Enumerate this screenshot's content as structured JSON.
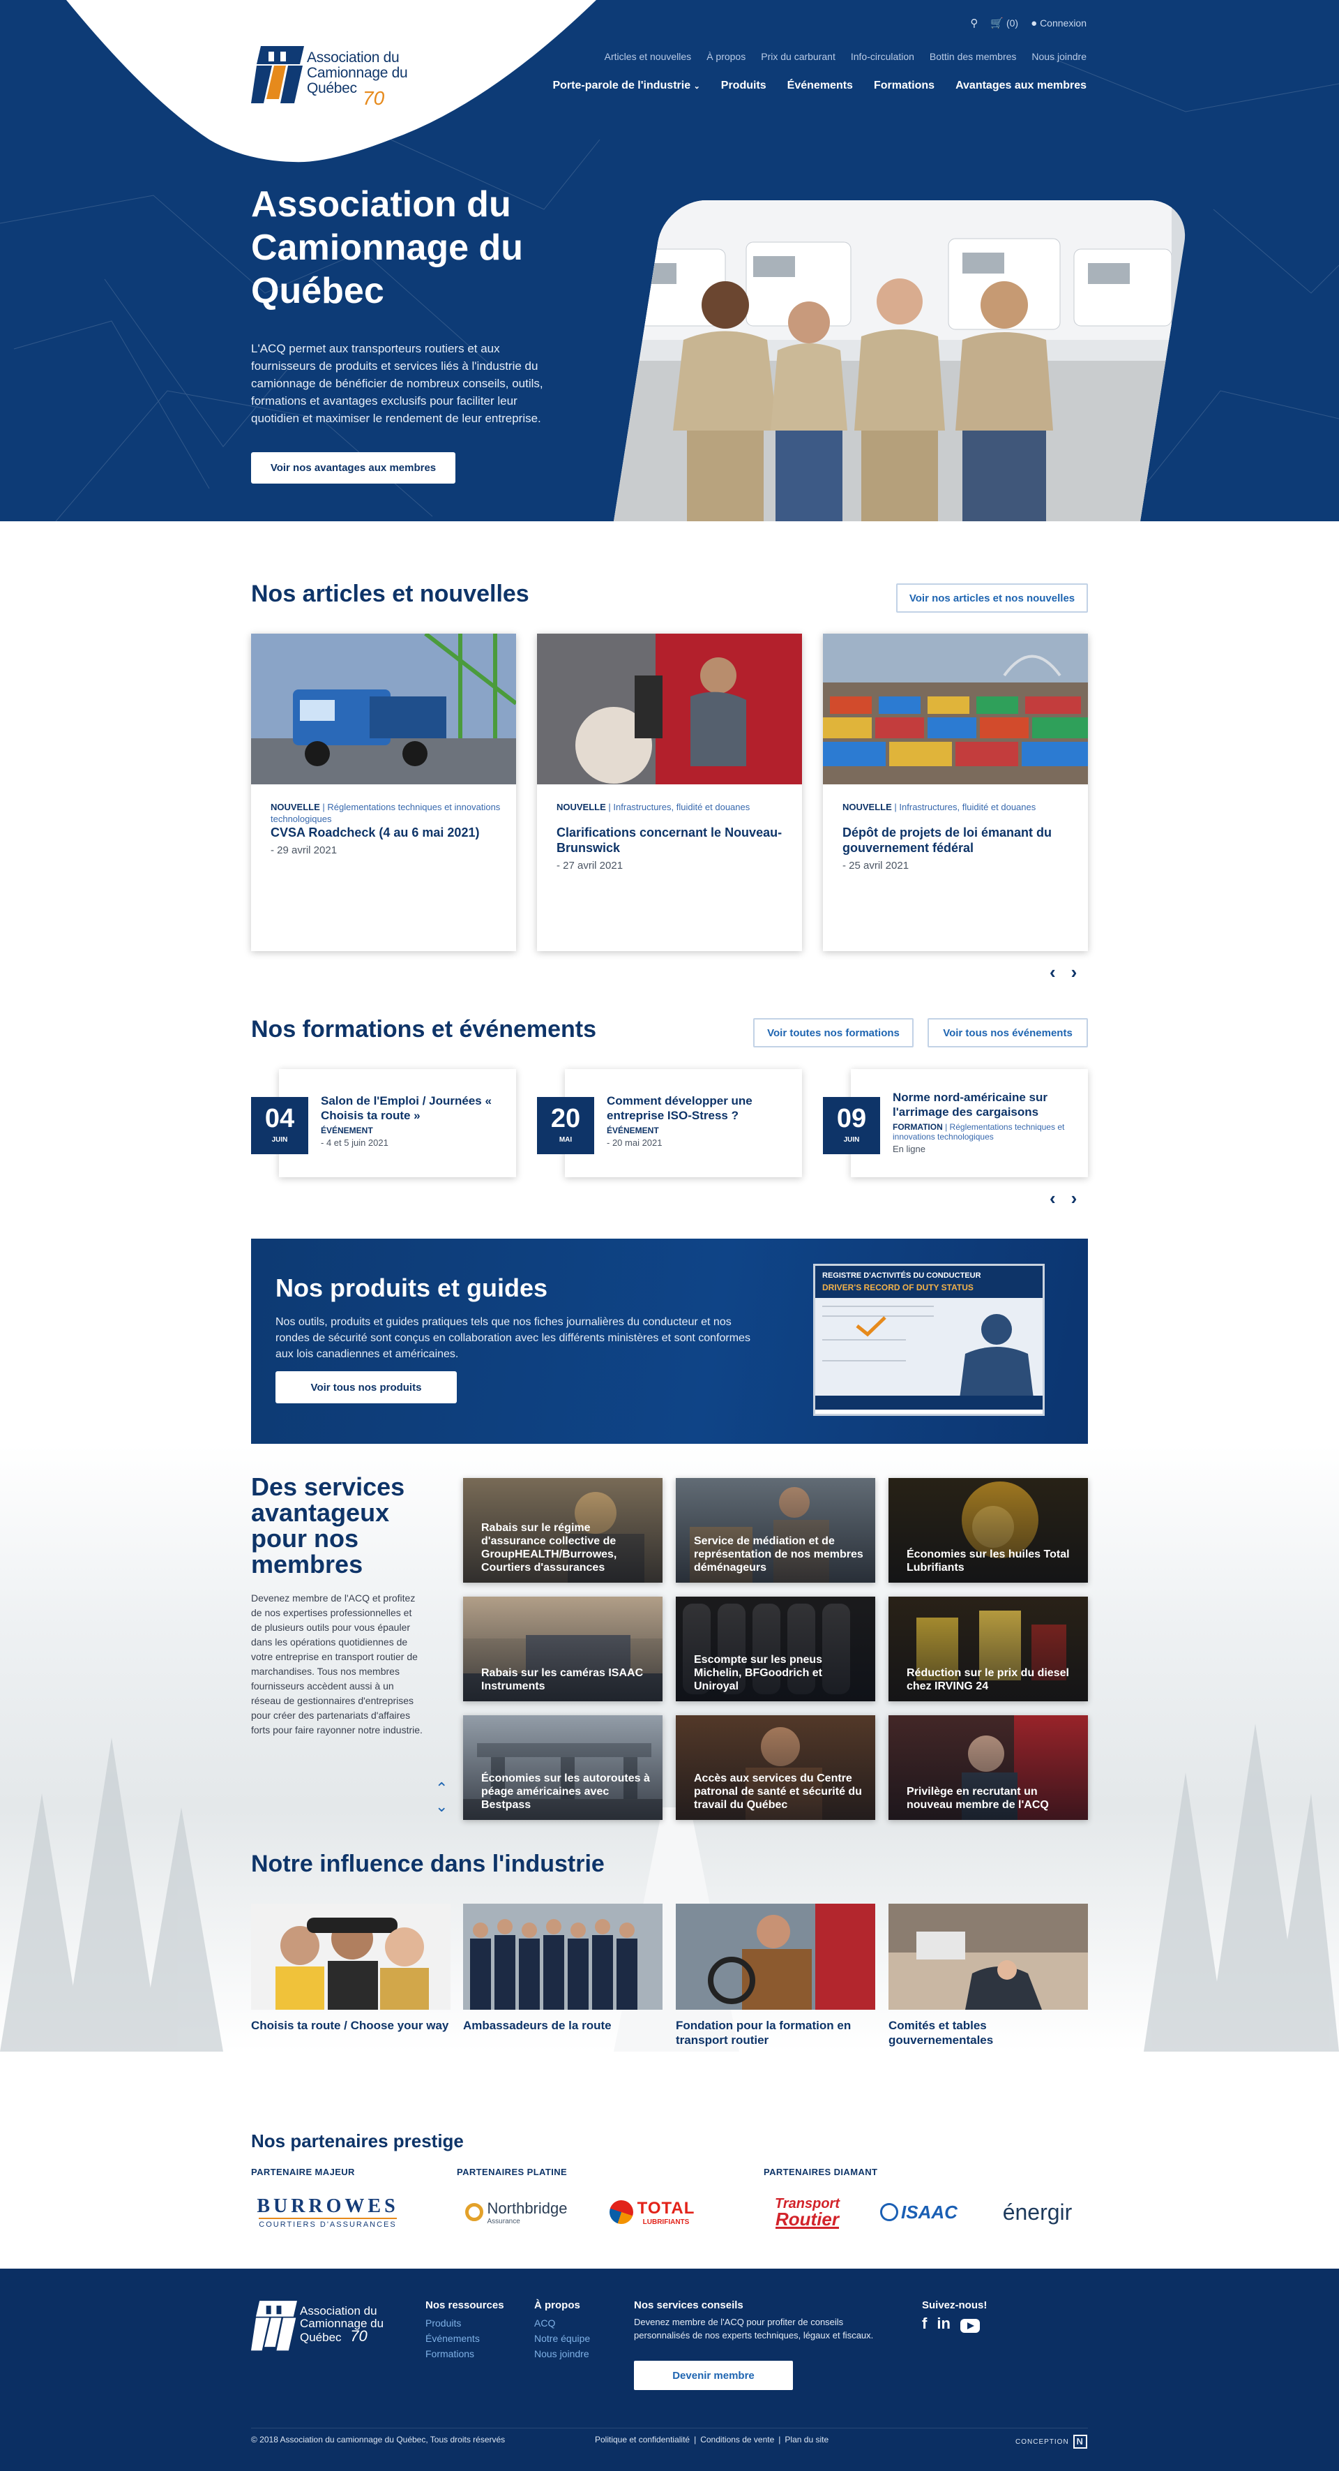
{
  "header": {
    "logo_line1": "Association du",
    "logo_line2": "Camionnage du",
    "logo_line3": "Québec",
    "logo_70": "70",
    "cart_label": "(0)",
    "login_label": "Connexion",
    "top_links": [
      "Articles et nouvelles",
      "À propos",
      "Prix du carburant",
      "Info-circulation",
      "Bottin des membres",
      "Nous joindre"
    ],
    "main_nav": [
      "Porte-parole de l'industrie",
      "Produits",
      "Événements",
      "Formations",
      "Avantages aux membres"
    ]
  },
  "hero": {
    "title": "Association du Camionnage du Québec",
    "intro": "L'ACQ permet aux transporteurs routiers et aux fournisseurs de produits et services liés à l'industrie du camionnage de bénéficier de nombreux conseils, outils, formations et avantages exclusifs pour faciliter leur quotidien et maximiser le rendement de leur entreprise.",
    "cta": "Voir nos avantages aux membres"
  },
  "articles": {
    "title": "Nos articles et nouvelles",
    "button": "Voir nos articles et nos nouvelles",
    "items": [
      {
        "type": "NOUVELLE",
        "category": "| Réglementations techniques et innovations technologiques",
        "title": "CVSA Roadcheck (4 au 6 mai 2021)",
        "date": "- 29 avril 2021"
      },
      {
        "type": "NOUVELLE",
        "category": "| Infrastructures, fluidité et douanes",
        "title": "Clarifications concernant le Nouveau-Brunswick",
        "date": "- 27 avril 2021"
      },
      {
        "type": "NOUVELLE",
        "category": "| Infrastructures, fluidité et douanes",
        "title": "Dépôt de projets de loi émanant du gouvernement fédéral",
        "date": "- 25 avril 2021"
      }
    ]
  },
  "events": {
    "title": "Nos formations et événements",
    "button_trainings": "Voir toutes nos formations",
    "button_events": "Voir tous nos événements",
    "items": [
      {
        "day": "04",
        "month": "JUIN",
        "title": "Salon de l'Emploi / Journées « Choisis ta route »",
        "type": "ÉVÉNEMENT",
        "category": "",
        "date": "- 4 et 5 juin 2021",
        "extra": ""
      },
      {
        "day": "20",
        "month": "MAI",
        "title": "Comment développer une entreprise ISO-Stress ?",
        "type": "ÉVÉNEMENT",
        "category": "",
        "date": "- 20 mai 2021",
        "extra": ""
      },
      {
        "day": "09",
        "month": "JUIN",
        "title": "Norme nord-américaine sur l'arrimage des cargaisons",
        "type": "FORMATION",
        "category": " | Réglementations techniques et innovations technologiques",
        "date": "En ligne",
        "extra": ""
      }
    ]
  },
  "products": {
    "title": "Nos produits et guides",
    "text": "Nos outils, produits et guides pratiques tels que nos fiches journalières du conducteur et nos rondes de sécurité sont conçus en collaboration avec les différents ministères et sont conformes aux lois canadiennes et américaines.",
    "cta": "Voir tous nos produits",
    "guide_title1": "REGISTRE D'ACTIVITÉS DU CONDUCTEUR",
    "guide_title2": "DRIVER'S RECORD OF DUTY STATUS"
  },
  "benefits": {
    "title": "Des services avantageux pour nos membres",
    "text": "Devenez membre de l'ACQ et profitez de nos expertises professionnelles et de plusieurs outils pour vous épauler dans les opérations quotidiennes de votre entreprise en transport routier de marchandises. Tous nos membres fournisseurs accèdent aussi à un réseau de gestionnaires d'entreprises pour créer des partenariats d'affaires forts pour faire rayonner notre industrie.",
    "tiles": [
      "Rabais sur le régime d'assurance collective de GroupHEALTH/Burrowes, Courtiers d'assurances",
      "Service de médiation et de représentation de nos membres déménageurs",
      "Économies sur les huiles Total Lubrifiants",
      "Rabais sur les caméras ISAAC Instruments",
      "Escompte sur les pneus Michelin, BFGoodrich et Uniroyal",
      "Réduction sur le prix du diesel chez IRVING 24",
      "Économies sur les autoroutes à péage américaines avec Bestpass",
      "Accès aux services du Centre patronal de santé et sécurité du travail du Québec",
      "Privilège en recrutant un nouveau membre de l'ACQ"
    ]
  },
  "influence": {
    "title": "Notre influence dans l'industrie",
    "items": [
      "Choisis ta route / Choose your way",
      "Ambassadeurs de la route",
      "Fondation pour la formation en transport routier",
      "Comités et tables gouvernementales"
    ]
  },
  "partners": {
    "title": "Nos partenaires prestige",
    "tier_major": "PARTENAIRE MAJEUR",
    "tier_platinum": "PARTENAIRES PLATINE",
    "tier_diamond": "PARTENAIRES DIAMANT",
    "burrowes": "BURROWES",
    "burrowes_sub": "COURTIERS D'ASSURANCES",
    "northbridge": "Northbridge",
    "northbridge_sub": "Assurance",
    "total": "TOTAL",
    "total_sub": "LUBRIFIANTS",
    "transport": "Transport",
    "routier": "Routier",
    "isaac": "ISAAC",
    "energir": "énergir"
  },
  "footer": {
    "resources_title": "Nos ressources",
    "resources": [
      "Produits",
      "Événements",
      "Formations"
    ],
    "about_title": "À propos",
    "about": [
      "ACQ",
      "Notre équipe",
      "Nous joindre"
    ],
    "services_title": "Nos services conseils",
    "services_text": "Devenez membre de l'ACQ pour profiter de conseils personnalisés de nos experts techniques, légaux et fiscaux.",
    "services_cta": "Devenir membre",
    "follow_title": "Suivez-nous!",
    "copyright": "© 2018 Association du camionnage du Québec, Tous droits réservés",
    "legal": [
      "Politique et confidentialité",
      "Conditions de vente",
      "Plan du site"
    ],
    "conception": "CONCEPTION"
  },
  "colors": {
    "navy": "#0e3468",
    "hero_blue": "#0d3b76",
    "accent_orange": "#e68a1c",
    "link_blue": "#1f65b1"
  }
}
